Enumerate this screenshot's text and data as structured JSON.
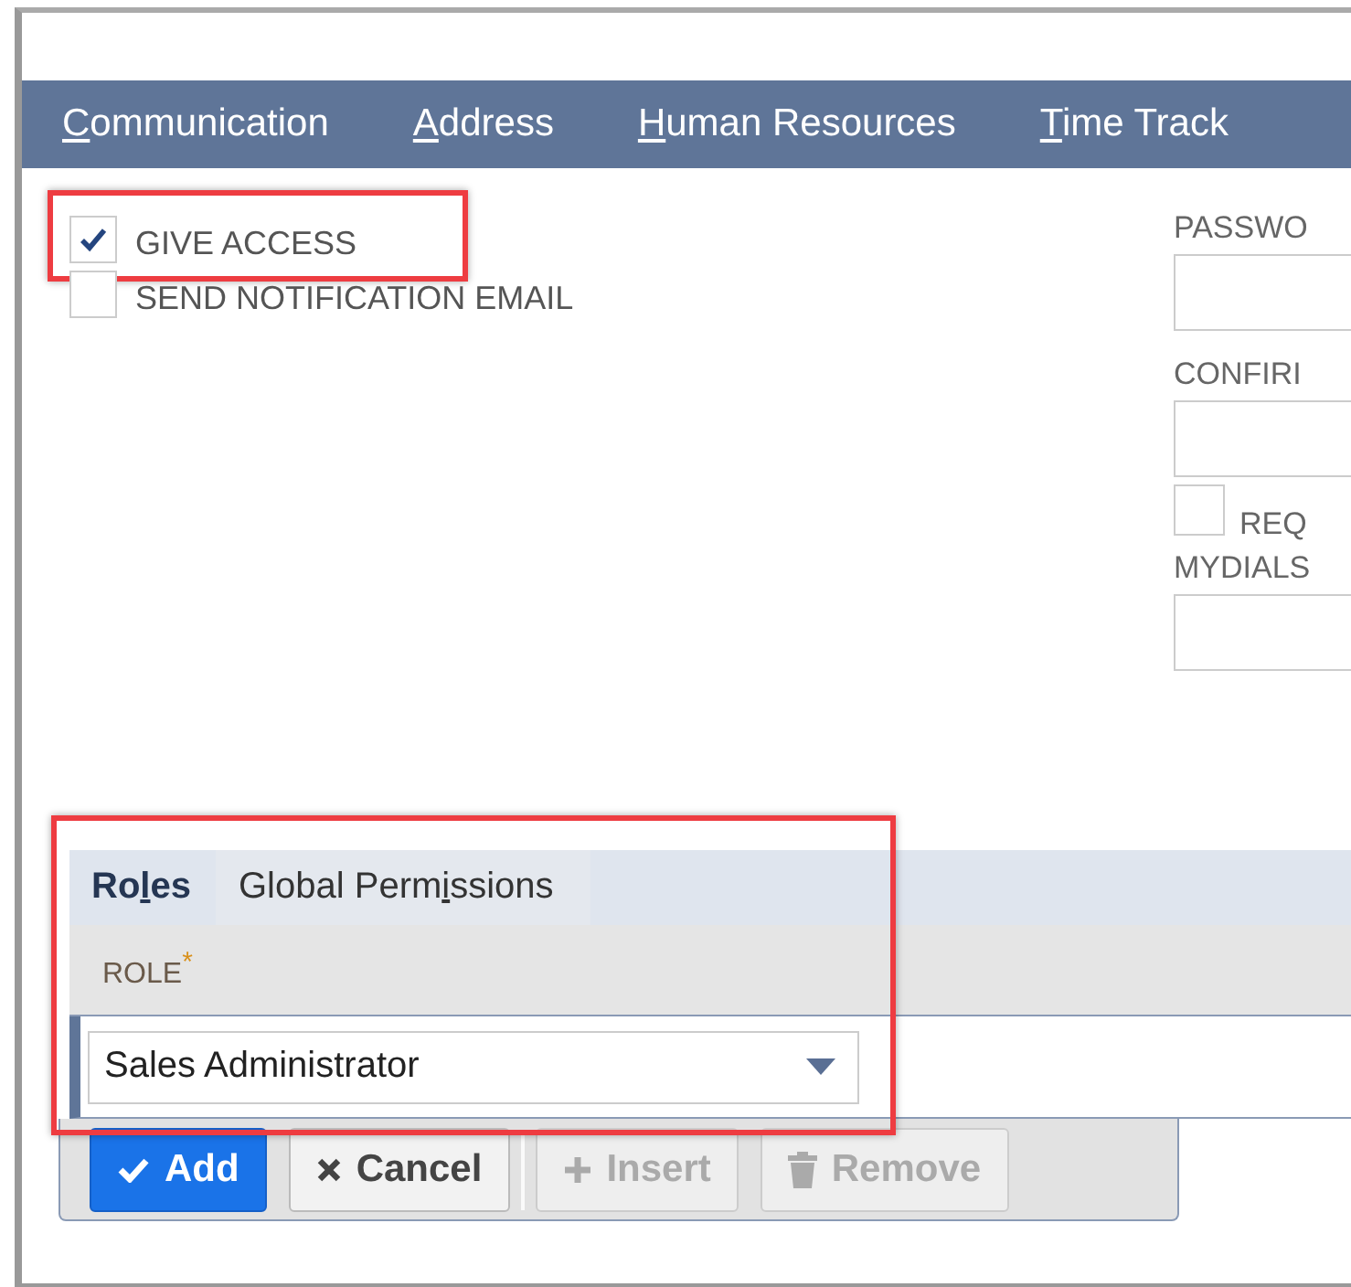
{
  "nav_tabs": [
    {
      "key": "C",
      "post": "ommunication"
    },
    {
      "key": "A",
      "post": "ddress"
    },
    {
      "key": "H",
      "post": "uman Resources"
    },
    {
      "key": "T",
      "post": "ime Track"
    }
  ],
  "access_options": [
    {
      "label": "GIVE ACCESS",
      "checked": true,
      "highlighted": true
    },
    {
      "label": "SEND NOTIFICATION EMAIL",
      "checked": false,
      "highlighted": false
    }
  ],
  "right_fields": [
    {
      "kind": "field",
      "label": "PASSWO"
    },
    {
      "kind": "field",
      "label": "CONFIRI"
    },
    {
      "kind": "checkbox",
      "label": "REQ",
      "checked": false
    },
    {
      "kind": "field",
      "label": "MYDIALS"
    }
  ],
  "subtabs": [
    {
      "pre": "Ro",
      "key": "l",
      "post": "es",
      "selected": true
    },
    {
      "pre": "Global Perm",
      "key": "i",
      "post": "ssions",
      "selected": false
    }
  ],
  "roles_highlighted": true,
  "role_column": {
    "label": "ROLE",
    "required_mark": "*"
  },
  "role_value": "Sales Administrator",
  "buttons": [
    {
      "kind": "primary",
      "label": "Add",
      "disabled": false
    },
    {
      "kind": "default",
      "label": "Cancel",
      "disabled": false
    },
    {
      "kind": "default",
      "label": "Insert",
      "disabled": true
    },
    {
      "kind": "default",
      "label": "Remove",
      "disabled": true
    }
  ]
}
